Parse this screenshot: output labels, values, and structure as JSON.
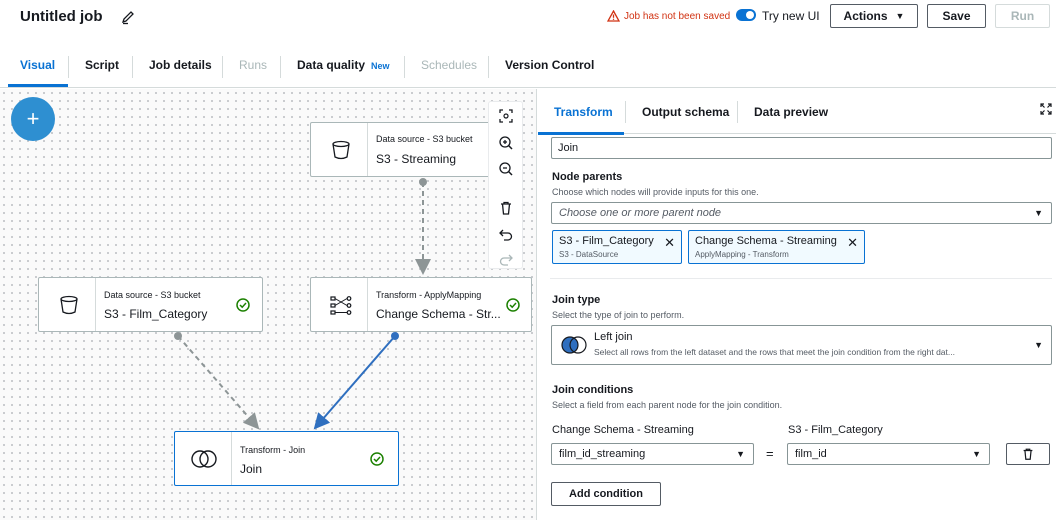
{
  "header": {
    "job_title": "Untitled job",
    "warning": "Job has not been saved",
    "try_new_ui": "Try new UI",
    "actions_label": "Actions",
    "save_label": "Save",
    "run_label": "Run"
  },
  "tabs": [
    {
      "label": "Visual"
    },
    {
      "label": "Script"
    },
    {
      "label": "Job details"
    },
    {
      "label": "Runs"
    },
    {
      "label": "Data quality"
    },
    {
      "label": "Schedules"
    },
    {
      "label": "Version Control"
    }
  ],
  "data_quality_badge": "New",
  "canvas": {
    "add_label": "+",
    "nodes": {
      "s3_streaming": {
        "type": "Data source - S3 bucket",
        "name": "S3 - Streaming"
      },
      "s3_film_category": {
        "type": "Data source - S3 bucket",
        "name": "S3 - Film_Category"
      },
      "change_schema": {
        "type": "Transform - ApplyMapping",
        "name": "Change Schema - Str..."
      },
      "join": {
        "type": "Transform - Join",
        "name": "Join"
      }
    }
  },
  "panel": {
    "tabs": [
      {
        "label": "Transform"
      },
      {
        "label": "Output schema"
      },
      {
        "label": "Data preview"
      }
    ],
    "name_value": "Join",
    "node_parents_label": "Node parents",
    "node_parents_hint": "Choose which nodes will provide inputs for this one.",
    "parents_placeholder": "Choose one or more parent node",
    "tokens": [
      {
        "name": "S3 - Film_Category",
        "sub": "S3 - DataSource"
      },
      {
        "name": "Change Schema - Streaming",
        "sub": "ApplyMapping - Transform"
      }
    ],
    "join_type_label": "Join type",
    "join_type_hint": "Select the type of join to perform.",
    "join_type_value": "Left join",
    "join_type_desc": "Select all rows from the left dataset and the rows that meet the join condition from the right dat...",
    "join_conditions_label": "Join conditions",
    "join_conditions_hint": "Select a field from each parent node for the join condition.",
    "left_parent": "Change Schema - Streaming",
    "right_parent": "S3 - Film_Category",
    "left_field": "film_id_streaming",
    "equals": "=",
    "right_field": "film_id",
    "add_condition": "Add condition"
  },
  "colors": {
    "accent": "#0972d3",
    "warning": "#d13212",
    "success": "#1d8102"
  }
}
